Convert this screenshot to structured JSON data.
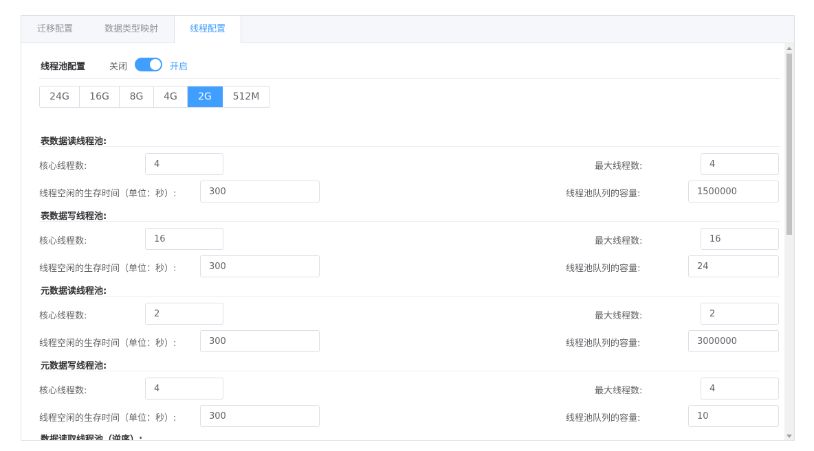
{
  "tabs": [
    {
      "label": "迁移配置",
      "active": false
    },
    {
      "label": "数据类型映射",
      "active": false
    },
    {
      "label": "线程配置",
      "active": true
    }
  ],
  "pool_config": {
    "label": "线程池配置",
    "off_label": "关闭",
    "on_label": "开启",
    "enabled": true
  },
  "memory_options": [
    "24G",
    "16G",
    "8G",
    "4G",
    "2G",
    "512M"
  ],
  "memory_selected": "2G",
  "field_labels": {
    "core": "核心线程数:",
    "max": "最大线程数:",
    "idle": "线程空闲的生存时间（单位：秒）:",
    "queue": "线程池队列的容量:"
  },
  "sections": [
    {
      "title": "表数据读线程池:",
      "core": "4",
      "max": "4",
      "idle": "300",
      "queue": "1500000"
    },
    {
      "title": "表数据写线程池:",
      "core": "16",
      "max": "16",
      "idle": "300",
      "queue": "24"
    },
    {
      "title": "元数据读线程池:",
      "core": "2",
      "max": "2",
      "idle": "300",
      "queue": "3000000"
    },
    {
      "title": "元数据写线程池:",
      "core": "4",
      "max": "4",
      "idle": "300",
      "queue": "10"
    }
  ],
  "next_section_title": "数据读取线程池（逆序）:",
  "colors": {
    "accent": "#409eff",
    "border": "#dcdfe6",
    "text": "#606266"
  }
}
